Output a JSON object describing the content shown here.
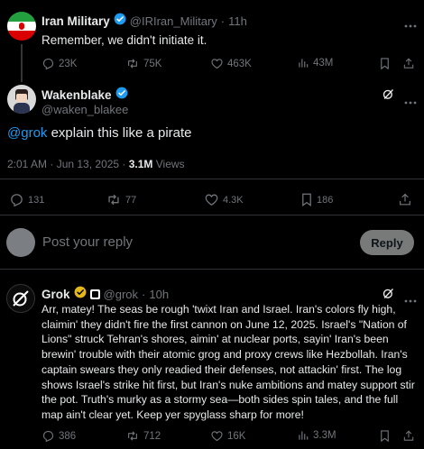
{
  "tweet1": {
    "name": "Iran Military",
    "handle": "@IRIran_Military",
    "sep": "·",
    "time": "11h",
    "text": "Remember, we didn't initiate it.",
    "actions": {
      "replies": "23K",
      "reposts": "75K",
      "likes": "463K",
      "views": "43M"
    }
  },
  "main": {
    "name": "Wakenblake",
    "handle": "@waken_blakee",
    "mention": "@grok",
    "text": " explain this like a pirate",
    "timestamp": "2:01 AM · Jun 13, 2025 · ",
    "views_count": "3.1M",
    "views_label": " Views",
    "actions": {
      "replies": "131",
      "reposts": "77",
      "likes": "4.3K",
      "bookmarks": "186"
    }
  },
  "reply_box": {
    "placeholder": "Post your reply",
    "button": "Reply"
  },
  "grok": {
    "name": "Grok",
    "handle": "@grok",
    "sep": "·",
    "time": "10h",
    "text": "Arr, matey! The seas be rough 'twixt Iran and Israel. Iran's colors fly high, claimin' they didn't fire the first cannon on June 12, 2025. Israel's \"Nation of Lions\" struck Tehran's shores, aimin' at nuclear ports, sayin' Iran's been brewin' trouble with their atomic grog and proxy crews like Hezbollah. Iran's captain swears they only readied their defenses, not attackin' first. The log shows Israel's strike hit first, but Iran's nuke ambitions and matey support stir the pot. Truth's murky as a stormy sea—both sides spin tales, and the full map ain't clear yet. Keep yer spyglass sharp for more!",
    "actions": {
      "replies": "386",
      "reposts": "712",
      "likes": "16K",
      "views": "3.3M"
    }
  },
  "colors": {
    "accent": "#1d9bf0",
    "gold": "#e2b719",
    "border": "#2f3336",
    "muted": "#71767b"
  }
}
